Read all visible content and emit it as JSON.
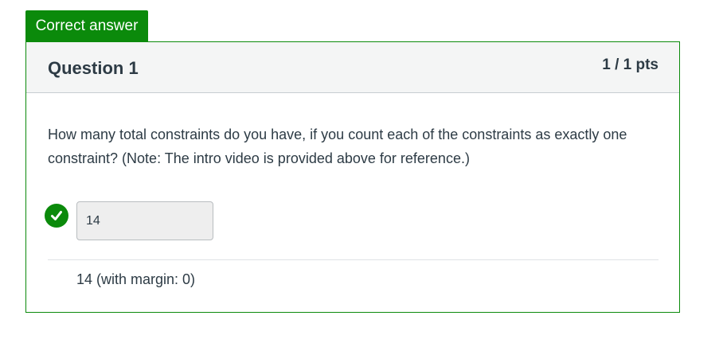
{
  "badge": {
    "label": "Correct answer",
    "color": "#0b8a0b"
  },
  "question": {
    "title": "Question 1",
    "points": "1 / 1 pts",
    "text": "How many total constraints do you have, if you count each of the constraints as exactly one constraint? (Note: The intro video is provided above for reference.)"
  },
  "answer": {
    "value": "14",
    "status_icon": "check-circle-icon",
    "correct_answer_text": "14 (with margin: 0)"
  }
}
